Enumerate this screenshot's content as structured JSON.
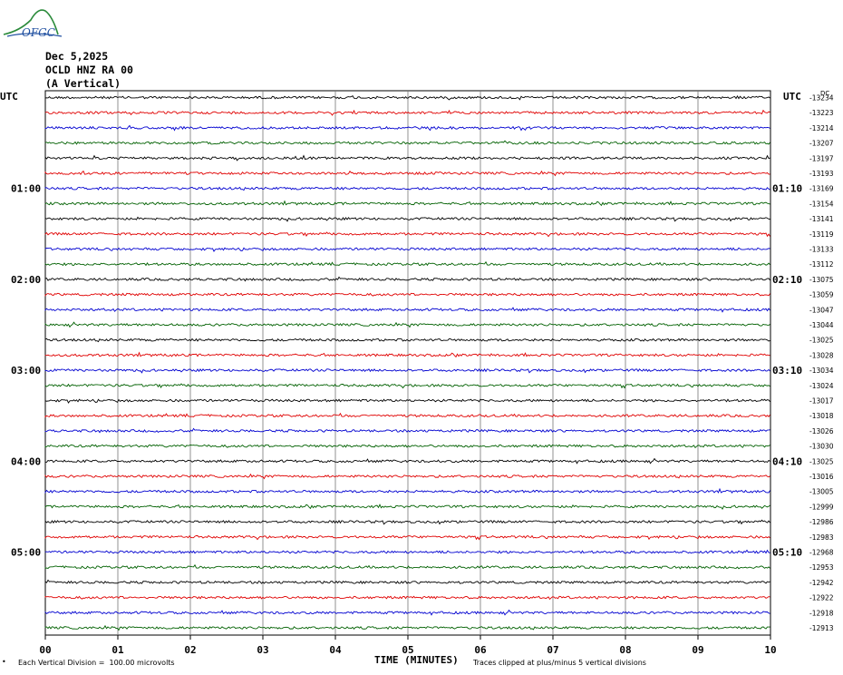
{
  "logo_text": "OFGC",
  "header": {
    "date": "Dec 5,2025",
    "station": "OCLD HNZ RA 00",
    "component": "(A Vertical)"
  },
  "chart_data": {
    "type": "line",
    "title": "Dec 5,2025 OCLD HNZ RA 00 (A Vertical)",
    "xlabel": "TIME (MINUTES)",
    "xlim": [
      0,
      10
    ],
    "x_ticks": [
      "00",
      "01",
      "02",
      "03",
      "04",
      "05",
      "06",
      "07",
      "08",
      "09",
      "10"
    ],
    "left_label": "UTC",
    "right_label": "UTC",
    "left_hour_labels": [
      {
        "row": 6,
        "text": "01:00"
      },
      {
        "row": 12,
        "text": "02:00"
      },
      {
        "row": 18,
        "text": "03:00"
      },
      {
        "row": 24,
        "text": "04:00"
      },
      {
        "row": 30,
        "text": "05:00"
      }
    ],
    "right_hour_labels": [
      {
        "row": 6,
        "text": "01:10"
      },
      {
        "row": 12,
        "text": "02:10"
      },
      {
        "row": 18,
        "text": "03:10"
      },
      {
        "row": 24,
        "text": "04:10"
      },
      {
        "row": 30,
        "text": "05:10"
      }
    ],
    "right_top_label": "DC",
    "dc_offsets": [
      "-13234",
      "-13223",
      "-13214",
      "-13207",
      "-13197",
      "-13193",
      "-13169",
      "-13154",
      "-13141",
      "-13119",
      "-13133",
      "-13112",
      "-13075",
      "-13059",
      "-13047",
      "-13044",
      "-13025",
      "-13028",
      "-13034",
      "-13024",
      "-13017",
      "-13018",
      "-13026",
      "-13030",
      "-13025",
      "-13016",
      "-13005",
      "-12999",
      "-12986",
      "-12983",
      "-12968",
      "-12953",
      "-12942",
      "-12922",
      "-12918",
      "-12913"
    ],
    "trace_colors": [
      "#000000",
      "#e00000",
      "#0000d0",
      "#006000"
    ],
    "row_count": 36,
    "grid": true,
    "footnote_left": "Each Vertical Division =  100.00 microvolts",
    "footnote_right": "Traces clipped at plus/minus 5 vertical divisions"
  }
}
